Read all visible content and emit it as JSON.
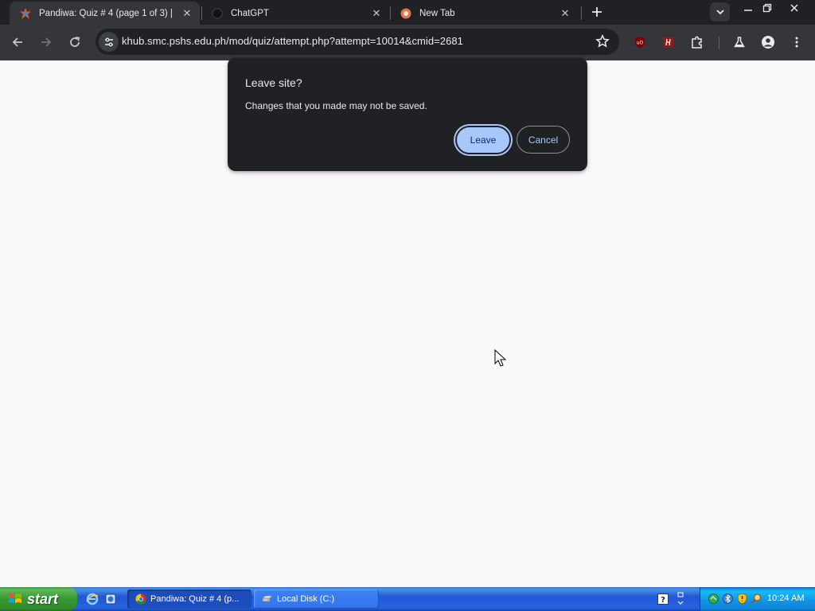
{
  "browser": {
    "tabs": [
      {
        "title": "Pandiwa: Quiz # 4 (page 1 of 3) | ",
        "active": true
      },
      {
        "title": "ChatGPT",
        "active": false
      },
      {
        "title": "New Tab",
        "active": false
      }
    ],
    "address_bar": {
      "url": "khub.smc.pshs.edu.ph/mod/quiz/attempt.php?attempt=10014&cmid=2681"
    }
  },
  "dialog": {
    "title": "Leave site?",
    "message": "Changes that you made may not be saved.",
    "primary_button": "Leave",
    "secondary_button": "Cancel"
  },
  "taskbar": {
    "start_label": "start",
    "items": [
      {
        "label": "Pandiwa: Quiz # 4 (p...",
        "active": true
      },
      {
        "label": "Local Disk (C:)",
        "active": false
      }
    ],
    "clock": "10:24 AM"
  },
  "colors": {
    "accent": "#a8c7fa",
    "dialog_bg": "#202124",
    "page_bg": "#f9f9f9"
  }
}
